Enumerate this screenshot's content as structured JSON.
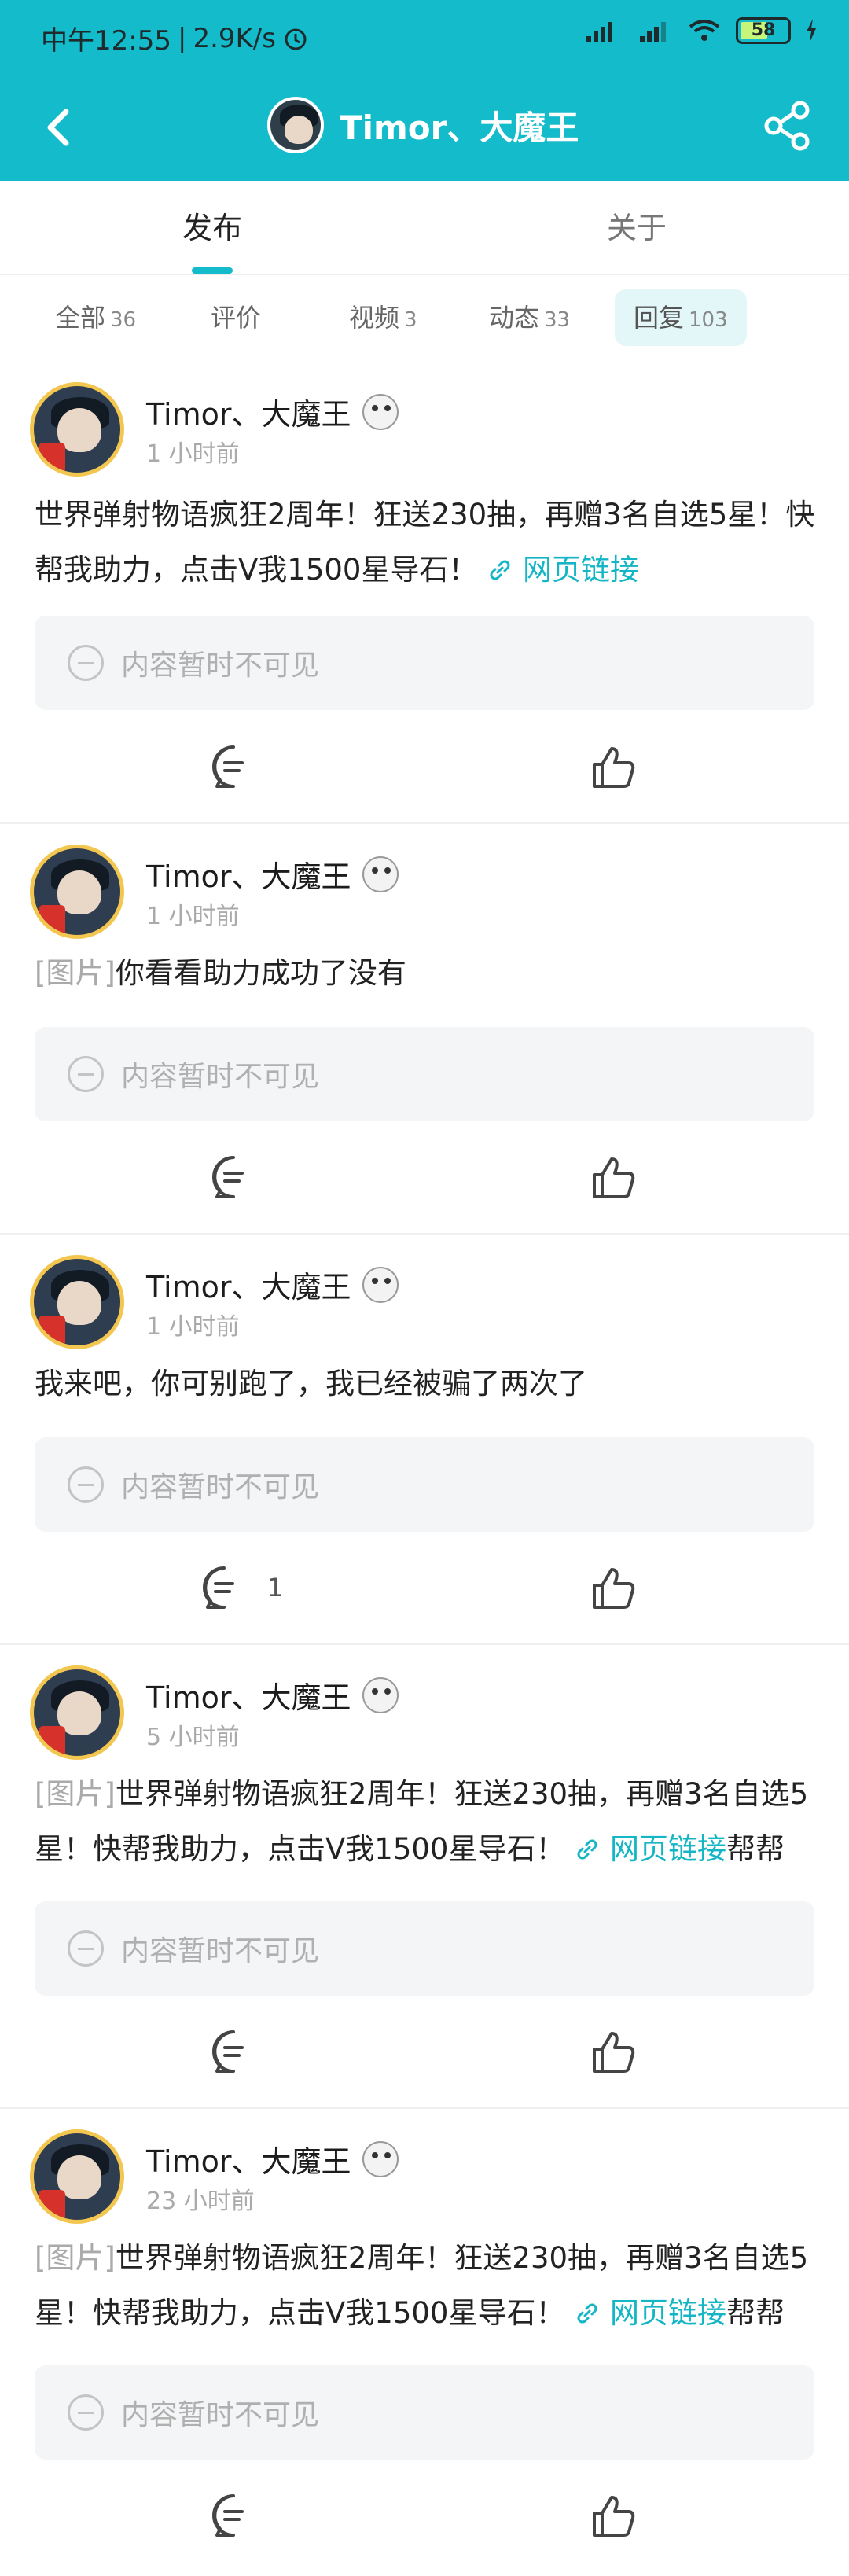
{
  "status_bar": {
    "time": "中午12:55",
    "speed": "2.9K/s",
    "battery": "58"
  },
  "header": {
    "title": "Timor、大魔王"
  },
  "tabs": [
    {
      "label": "发布"
    },
    {
      "label": "关于"
    }
  ],
  "filters": [
    {
      "label": "全部",
      "count": "36"
    },
    {
      "label": "评价",
      "count": ""
    },
    {
      "label": "视频",
      "count": "3"
    },
    {
      "label": "动态",
      "count": "33"
    },
    {
      "label": "回复",
      "count": "103"
    }
  ],
  "posts": [
    {
      "username": "Timor、大魔王",
      "time": "1 小时前",
      "tag": "",
      "text": "世界弹射物语疯狂2周年！狂送230抽，再赠3名自选5星！快帮我助力，点击V我1500星导石！",
      "link": "网页链接",
      "after": "",
      "hidden": "内容暂时不可见",
      "comment_count": ""
    },
    {
      "username": "Timor、大魔王",
      "time": "1 小时前",
      "tag": "[图片]",
      "text": "你看看助力成功了没有",
      "link": "",
      "after": "",
      "hidden": "内容暂时不可见",
      "comment_count": ""
    },
    {
      "username": "Timor、大魔王",
      "time": "1 小时前",
      "tag": "",
      "text": "我来吧，你可别跑了，我已经被骗了两次了",
      "link": "",
      "after": "",
      "hidden": "内容暂时不可见",
      "comment_count": "1"
    },
    {
      "username": "Timor、大魔王",
      "time": "5 小时前",
      "tag": "[图片]",
      "text": "世界弹射物语疯狂2周年！狂送230抽，再赠3名自选5星！快帮我助力，点击V我1500星导石！",
      "link": "网页链接",
      "after": "帮帮",
      "hidden": "内容暂时不可见",
      "comment_count": ""
    },
    {
      "username": "Timor、大魔王",
      "time": "23 小时前",
      "tag": "[图片]",
      "text": "世界弹射物语疯狂2周年！狂送230抽，再赠3名自选5星！快帮我助力，点击V我1500星导石！",
      "link": "网页链接",
      "after": "帮帮",
      "hidden": "内容暂时不可见",
      "comment_count": ""
    }
  ],
  "colors": {
    "accent": "#14bccb",
    "link": "#14b5c4"
  }
}
